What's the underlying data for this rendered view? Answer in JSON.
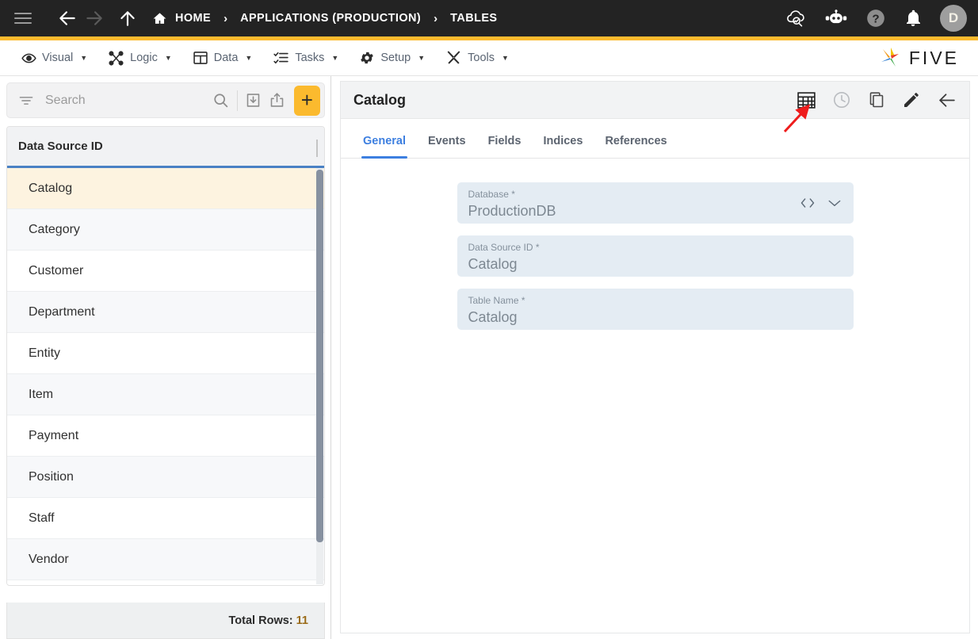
{
  "topbar": {
    "menu_icon": "hamburger-menu-icon",
    "back_icon": "arrow-left-icon",
    "forward_icon": "arrow-right-icon",
    "up_icon": "arrow-up-icon",
    "breadcrumbs": [
      {
        "label": "HOME",
        "icon": "home-icon"
      },
      {
        "label": "APPLICATIONS (PRODUCTION)",
        "icon": ""
      },
      {
        "label": "TABLES",
        "icon": ""
      }
    ],
    "separator": "›",
    "right_icons": [
      "cloud-search-icon",
      "chatbot-icon",
      "help-icon",
      "bell-icon"
    ],
    "avatar_initial": "D",
    "accent_color": "#FBBA2E",
    "background_color": "#232323"
  },
  "menubar": {
    "items": [
      {
        "label": "Visual",
        "icon": "eye-icon",
        "caret": "▼"
      },
      {
        "label": "Logic",
        "icon": "logic-nodes-icon",
        "caret": "▼"
      },
      {
        "label": "Data",
        "icon": "table-grid-icon",
        "caret": "▼"
      },
      {
        "label": "Tasks",
        "icon": "checklist-icon",
        "caret": "▼"
      },
      {
        "label": "Setup",
        "icon": "gear-icon",
        "caret": "▼"
      },
      {
        "label": "Tools",
        "icon": "tools-cross-icon",
        "caret": "▼"
      }
    ],
    "brand": "FIVE"
  },
  "sidebar": {
    "search": {
      "placeholder": "Search",
      "filter_icon": "filter-icon",
      "search_icon": "search-icon",
      "import_icon": "import-download-icon",
      "export_icon": "export-upload-icon",
      "add_label": "+"
    },
    "grid": {
      "column_header": "Data Source ID",
      "rows": [
        "Catalog",
        "Category",
        "Customer",
        "Department",
        "Entity",
        "Item",
        "Payment",
        "Position",
        "Staff",
        "Vendor"
      ],
      "selected_row": "Catalog"
    },
    "footer": {
      "total_label": "Total Rows:",
      "total_count": "11"
    }
  },
  "detail": {
    "title": "Catalog",
    "toolbar": [
      {
        "name": "table-grid-icon",
        "state": "active"
      },
      {
        "name": "history-clock-icon",
        "state": "muted"
      },
      {
        "name": "copy-icon",
        "state": "normal"
      },
      {
        "name": "edit-pencil-icon",
        "state": "normal"
      },
      {
        "name": "back-arrow-icon",
        "state": "normal"
      }
    ],
    "tabs": [
      {
        "label": "General",
        "active": true
      },
      {
        "label": "Events",
        "active": false
      },
      {
        "label": "Fields",
        "active": false
      },
      {
        "label": "Indices",
        "active": false
      },
      {
        "label": "References",
        "active": false
      }
    ],
    "fields": [
      {
        "label": "Database *",
        "value": "ProductionDB",
        "icons": [
          "code-brackets-icon",
          "chevron-down-icon"
        ]
      },
      {
        "label": "Data Source ID *",
        "value": "Catalog",
        "icons": []
      },
      {
        "label": "Table Name *",
        "value": "Catalog",
        "icons": []
      }
    ]
  },
  "annotation": {
    "arrow_color": "#ee1c1c",
    "points_at": "table-grid-icon"
  }
}
